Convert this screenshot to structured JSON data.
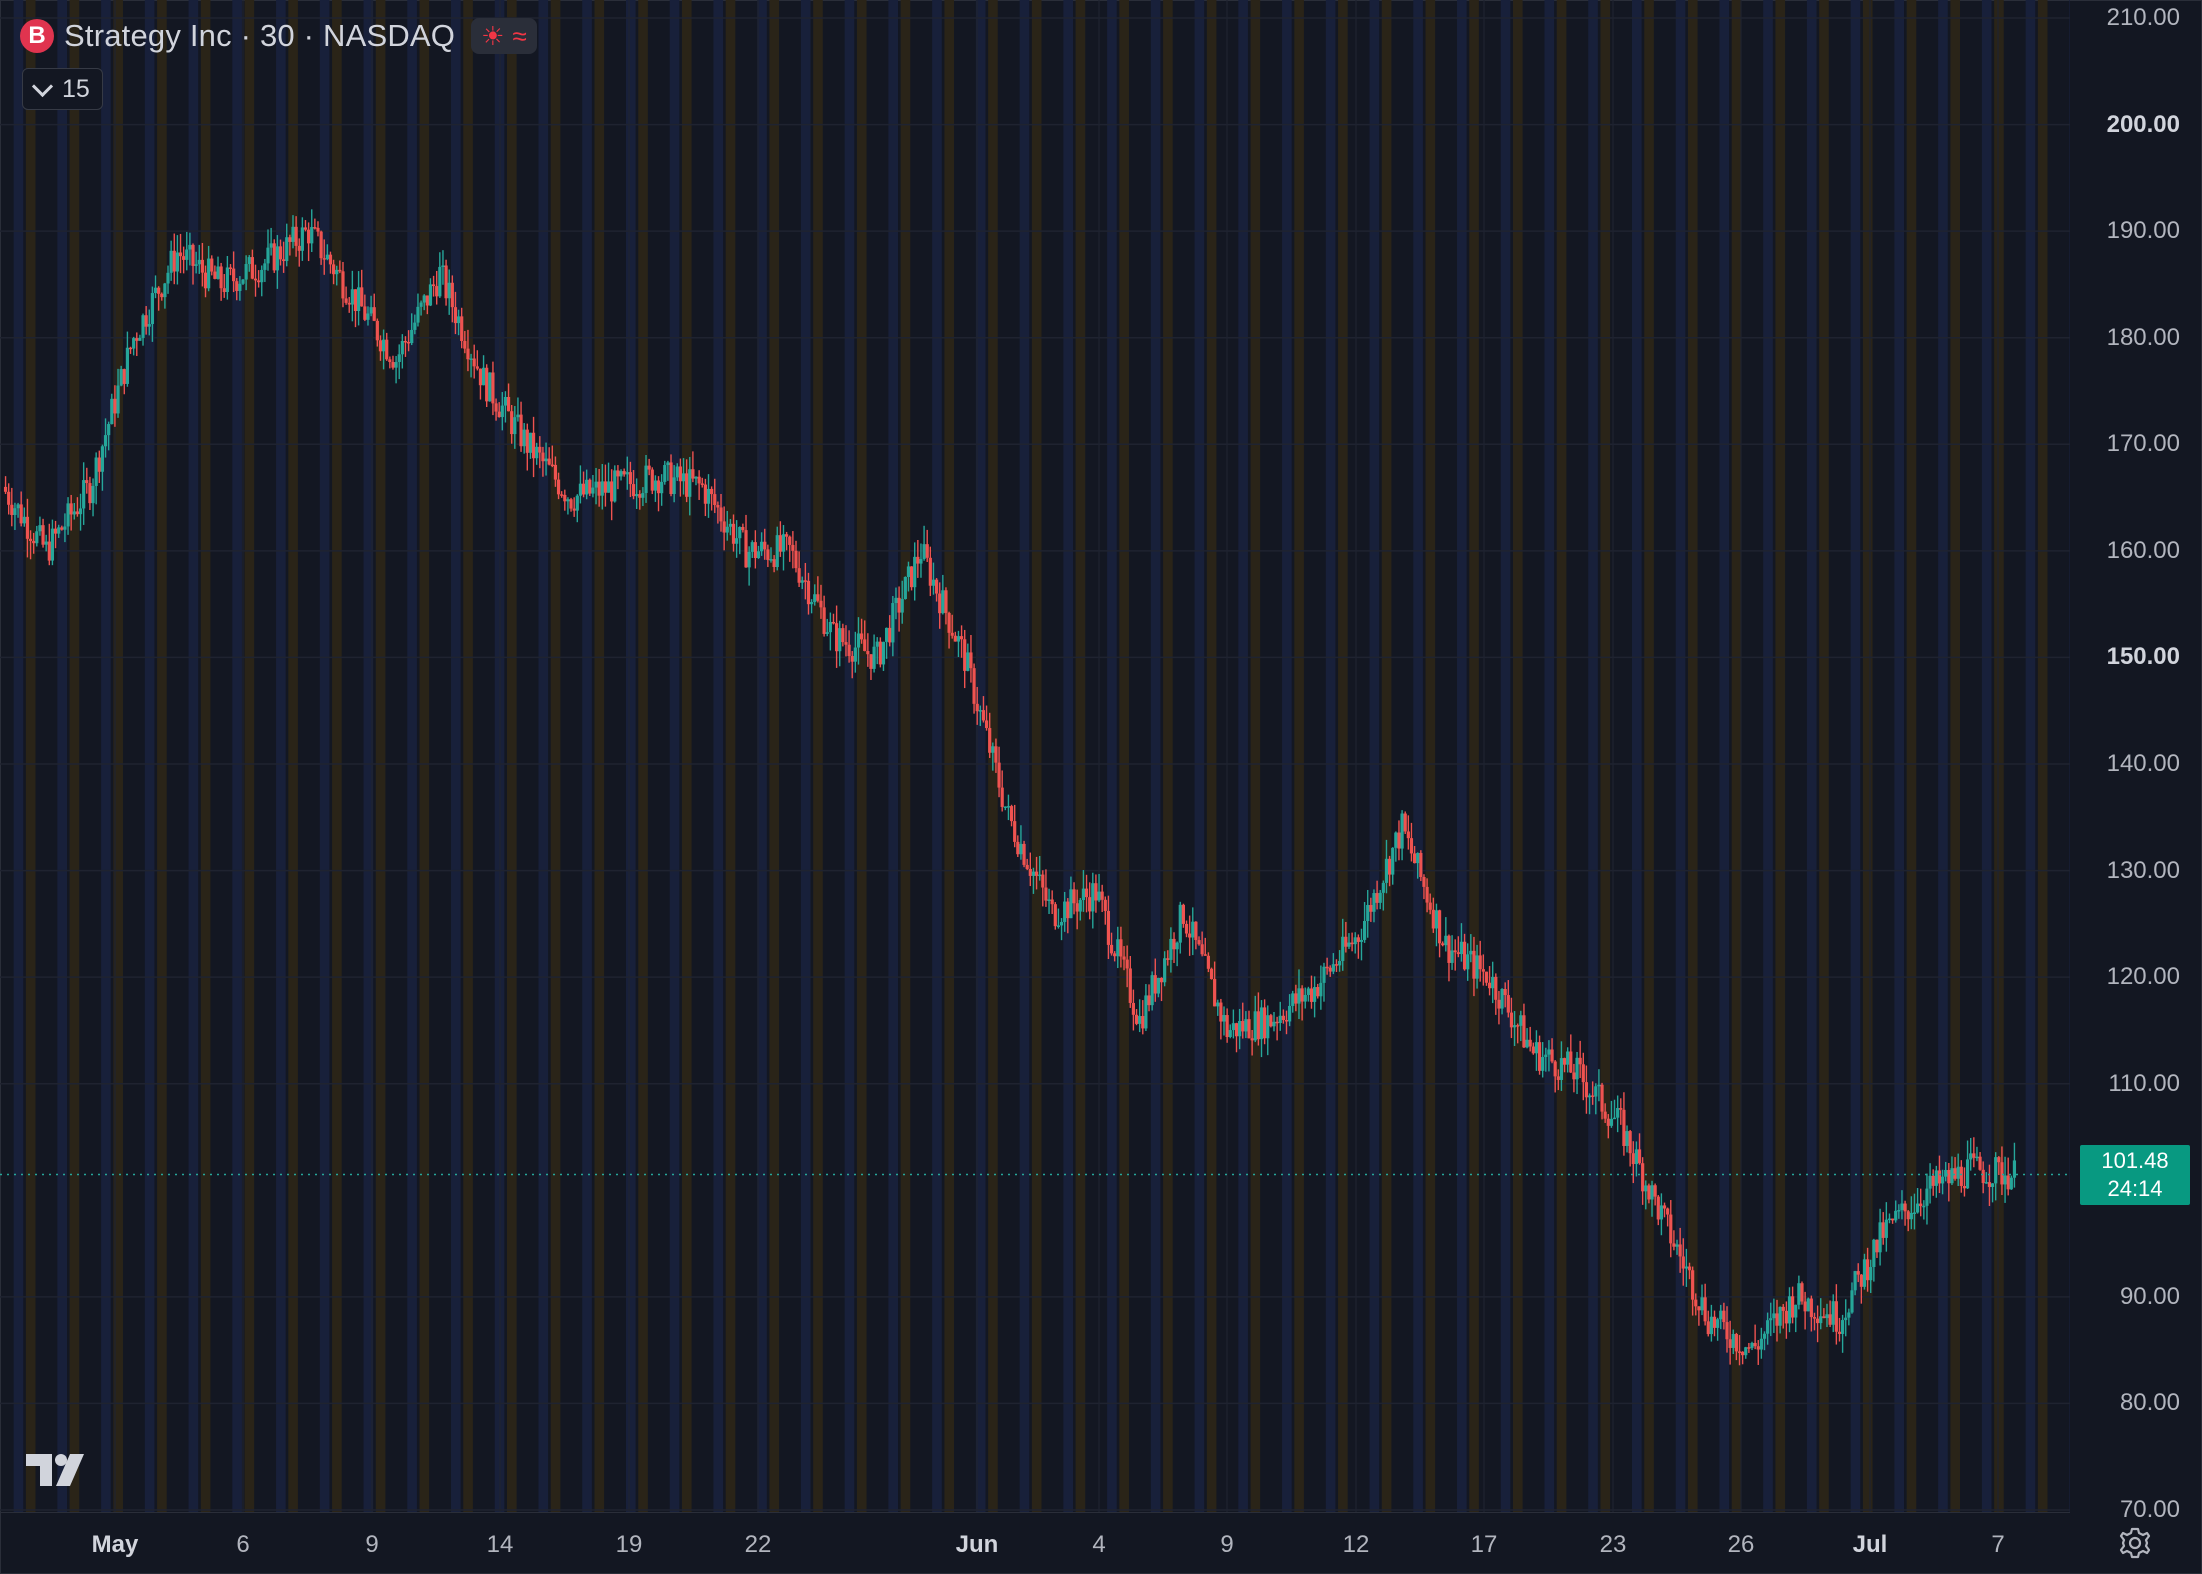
{
  "symbol": {
    "logo_letter": "B",
    "title": "Strategy Inc · 30 · NASDAQ",
    "status_icons": [
      "sun-icon",
      "wave-icon"
    ]
  },
  "indicator_badge": {
    "value": "15"
  },
  "last_price": {
    "price": "101.48",
    "countdown": "24:14"
  },
  "colors": {
    "background": "#131722",
    "up": "#26a69a",
    "down": "#ef5350",
    "session_premarket": "#2a2418",
    "session_postmarket": "#18203a",
    "price_tag": "#089981"
  },
  "icons": {
    "logo": "tradingview-logo-icon",
    "settings": "gear-icon"
  },
  "chart_data": {
    "type": "line",
    "series": [
      {
        "x": [
          "Apr 30",
          "May 1",
          "May 2",
          "May 5",
          "May 6",
          "May 7",
          "May 8",
          "May 9",
          "May 12",
          "May 13",
          "May 14",
          "May 15",
          "May 16",
          "May 19",
          "May 20",
          "May 21",
          "May 22",
          "May 23",
          "May 27",
          "May 28",
          "May 29",
          "May 30",
          "Jun 2",
          "Jun 3",
          "Jun 4",
          "Jun 5",
          "Jun 6",
          "Jun 9",
          "Jun 10",
          "Jun 11",
          "Jun 12",
          "Jun 13",
          "Jun 16",
          "Jun 17",
          "Jun 18",
          "Jun 20",
          "Jun 23",
          "Jun 24",
          "Jun 25",
          "Jun 26",
          "Jun 27",
          "Jun 30",
          "Jul 1",
          "Jul 2",
          "Jul 3",
          "Jul 7",
          "Jul 8"
        ],
        "values": [
          166,
          160,
          166,
          180,
          188,
          185,
          187,
          190,
          184,
          178,
          186,
          176,
          170,
          165,
          166,
          167,
          166,
          160,
          160,
          152,
          150,
          160,
          150,
          135,
          126,
          128,
          116,
          126,
          115,
          116,
          119,
          124,
          134,
          123,
          120,
          113,
          111,
          106,
          97,
          88,
          85,
          90,
          88,
          96,
          100,
          102,
          101.48
        ]
      }
    ],
    "x_tick_labels": [
      "May",
      "6",
      "9",
      "14",
      "19",
      "22",
      "Jun",
      "4",
      "9",
      "12",
      "17",
      "23",
      "26",
      "Jul",
      "7"
    ],
    "y_tick_labels": [
      "70.00",
      "80.00",
      "90.00",
      "110.00",
      "120.00",
      "130.00",
      "140.00",
      "150.00",
      "160.00",
      "170.00",
      "180.00",
      "190.00",
      "200.00",
      "210.00"
    ],
    "ylim": [
      70,
      210
    ],
    "grid": true,
    "last_value": 101.48
  }
}
